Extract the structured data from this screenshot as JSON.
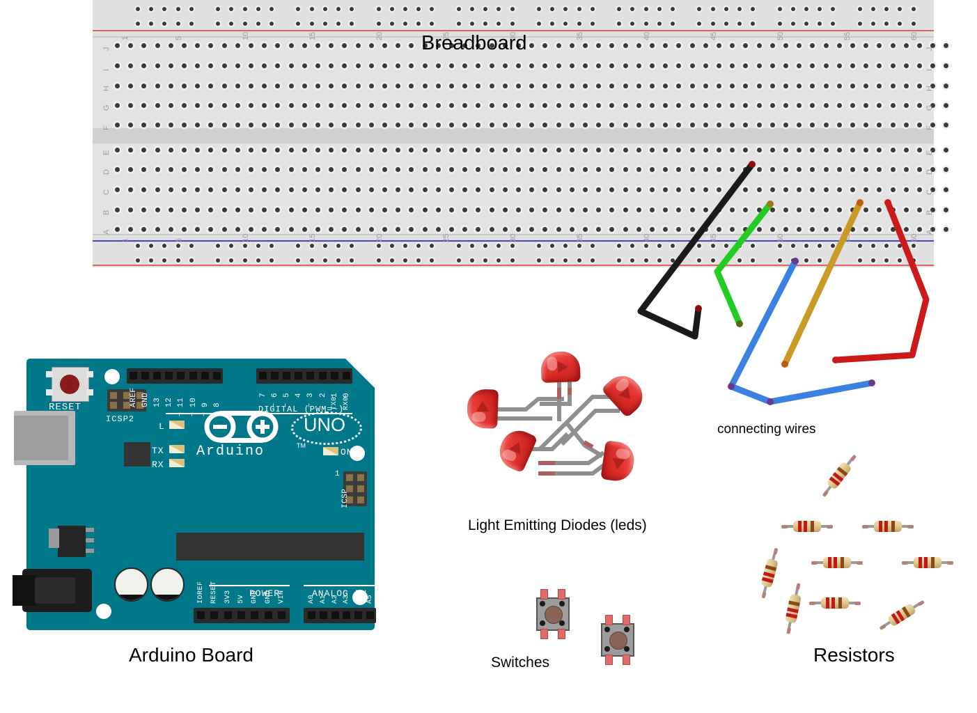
{
  "labels": {
    "breadboard": "Breadboard",
    "arduino_board": "Arduino Board",
    "leds": "Light Emitting Diodes (leds)",
    "switches": "Switches",
    "resistors": "Resistors",
    "connecting_wires": "connecting wires"
  },
  "breadboard": {
    "column_numbers": [
      "1",
      "5",
      "10",
      "15",
      "20",
      "25",
      "30",
      "35",
      "40",
      "45",
      "50",
      "55",
      "60"
    ],
    "upper_rows": [
      "J",
      "I",
      "H",
      "G",
      "F"
    ],
    "lower_rows": [
      "E",
      "D",
      "C",
      "B",
      "A"
    ],
    "rail_colors": {
      "negative": "#4646c8",
      "positive": "#e06464"
    },
    "body_color": "#e3e3e3",
    "columns_total": 63
  },
  "arduino": {
    "brand": "Arduino",
    "trademark": "TM",
    "model": "UNO",
    "reset_label": "RESET",
    "icsp2_label": "ICSP2",
    "icsp_label": "ICSP",
    "icsp_pin1": "1",
    "digital_label": "DIGITAL  (PWM=~)",
    "power_label": "POWER",
    "analog_label": "ANALOG IN",
    "status_leds": [
      {
        "name": "L",
        "label": "L"
      },
      {
        "name": "TX",
        "label": "TX"
      },
      {
        "name": "RX",
        "label": "RX"
      },
      {
        "name": "ON",
        "label": "ON"
      }
    ],
    "digital_left_pins": [
      "AREF",
      "GND",
      "13",
      "12",
      "11",
      "10",
      "9",
      "8"
    ],
    "digital_left_pwm": [
      "",
      "",
      "",
      "",
      "~",
      "~",
      "~",
      ""
    ],
    "digital_right_pins": [
      "7",
      "6",
      "5",
      "4",
      "3",
      "2",
      "1",
      "0"
    ],
    "digital_right_pwm": [
      "",
      "~",
      "~",
      "",
      "~",
      "",
      "",
      ""
    ],
    "digital_right_alt": [
      "",
      "",
      "",
      "",
      "",
      "",
      "TX0",
      "RX0"
    ],
    "power_pins": [
      "IOREF",
      "RESET",
      "3V3",
      "5V",
      "GND",
      "GND",
      "VIN"
    ],
    "analog_pins": [
      "A0",
      "A1",
      "A2",
      "A3",
      "A4",
      "A5"
    ],
    "pcb_color": "#00788a"
  },
  "components": {
    "led_count": 5,
    "led_color": "#e2332e",
    "switch_count": 2,
    "switch_body_color": "#9d9d9d",
    "resistor_count": 9,
    "resistor_bands": [
      "red",
      "red",
      "brown"
    ],
    "wire_colors": [
      "#1a1a1a",
      "#22cc22",
      "#3b82e0",
      "#c99a24",
      "#cc1a1a"
    ]
  }
}
